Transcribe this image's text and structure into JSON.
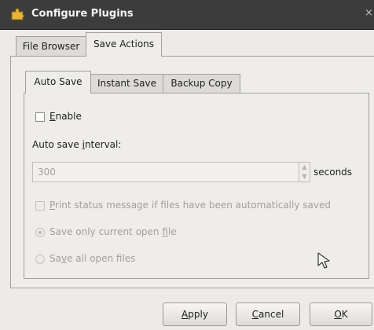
{
  "window": {
    "title": "Configure Plugins",
    "close_glyph": "×",
    "icon": "plugin-puzzle-icon"
  },
  "outer_tabs": [
    {
      "label": "File Browser",
      "active": false
    },
    {
      "label": "Save Actions",
      "active": true
    }
  ],
  "inner_tabs": [
    {
      "label": "Auto Save",
      "active": true
    },
    {
      "label": "Instant Save",
      "active": false
    },
    {
      "label": "Backup Copy",
      "active": false
    }
  ],
  "auto_save": {
    "enable": {
      "mnemonic": "E",
      "rest": "nable",
      "checked": false
    },
    "interval_label": {
      "before": "Auto save ",
      "mnemonic": "i",
      "after": "nterval:"
    },
    "interval_value": "300",
    "interval_unit": "seconds",
    "print_status": {
      "mnemonic": "P",
      "rest": "rint status message if files have been automatically saved",
      "checked": false
    },
    "save_current": {
      "before": "Save only current open ",
      "mnemonic": "f",
      "after": "ile",
      "selected": true
    },
    "save_all": {
      "before": "Sa",
      "mnemonic": "v",
      "after": "e all open files",
      "selected": false
    }
  },
  "buttons": {
    "apply": {
      "mnemonic": "A",
      "rest": "pply"
    },
    "cancel": {
      "mnemonic": "C",
      "rest": "ancel"
    },
    "ok": {
      "mnemonic": "O",
      "rest": "K"
    }
  },
  "colors": {
    "titlebar": "#3c3c3c",
    "window_bg": "#ecebe8",
    "disabled_text": "#a3a09b"
  }
}
